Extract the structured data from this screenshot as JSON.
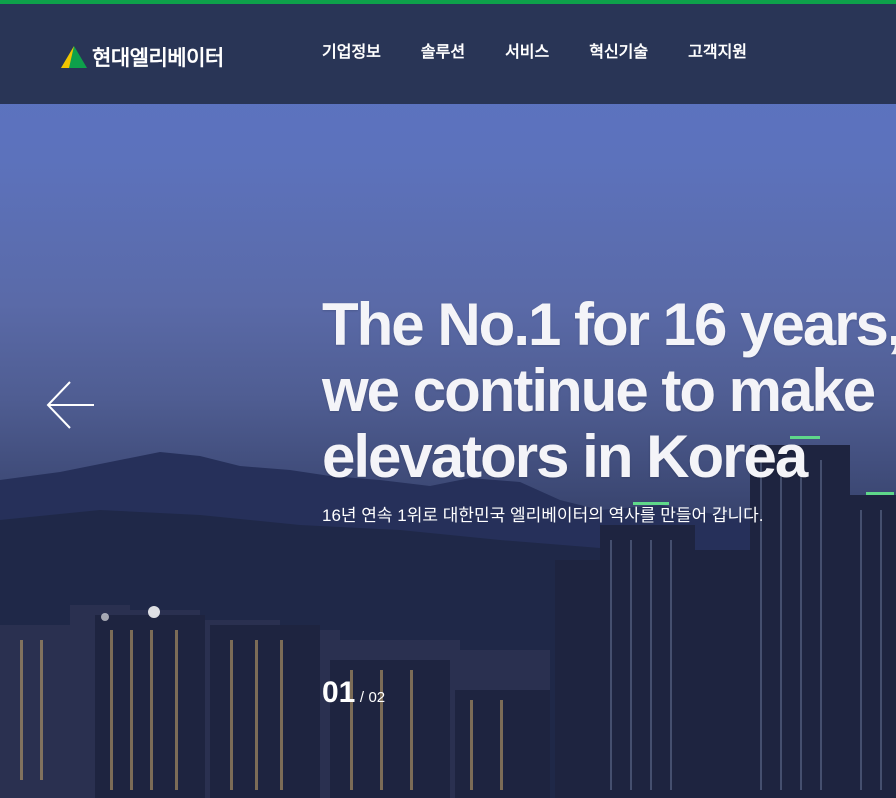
{
  "brand": {
    "name": "현대엘리베이터",
    "logo_icon": "triangle-logo-icon",
    "accent": "#0ea14b"
  },
  "nav": {
    "items": [
      {
        "label": "기업정보"
      },
      {
        "label": "솔루션"
      },
      {
        "label": "서비스"
      },
      {
        "label": "혁신기술"
      },
      {
        "label": "고객지원"
      }
    ]
  },
  "hero": {
    "headline": [
      "The No.1 for 16 years,",
      "we continue to make",
      "elevators in Korea"
    ],
    "subtitle": "16년 연속 1위로 대한민국 엘리베이터의 역사를 만들어 갑니다.",
    "prev_icon": "arrow-left-icon",
    "slide": {
      "current": "01",
      "separator": "/",
      "total": "02"
    }
  }
}
